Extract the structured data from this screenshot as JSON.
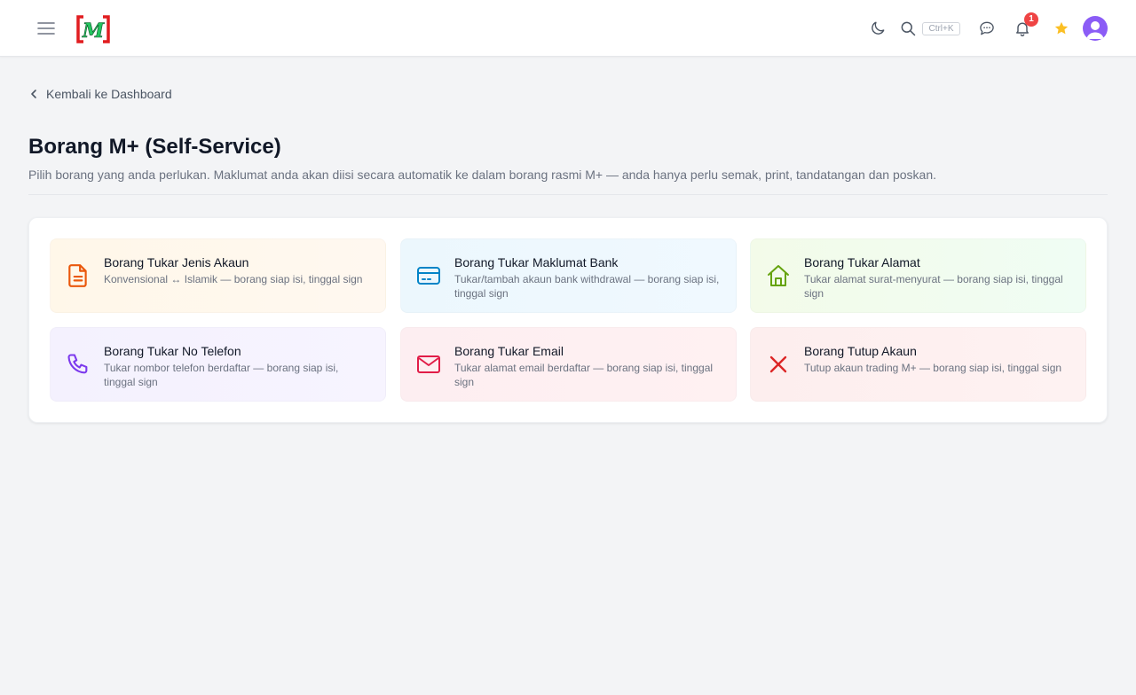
{
  "header": {
    "logo_text": "M",
    "search_shortcut": "Ctrl+K",
    "notification_count": "1",
    "icons": [
      "menu-icon",
      "moon-icon",
      "search-icon",
      "chat-icon",
      "bell-icon",
      "star-icon",
      "user-icon"
    ],
    "colors": {
      "star": "#fbbf24",
      "avatar": "#8b5cf6",
      "badge": "#ef4444"
    }
  },
  "nav": {
    "back_label": "Kembali ke Dashboard"
  },
  "page": {
    "title": "Borang M+ (Self-Service)",
    "description": "Pilih borang yang anda perlukan. Maklumat anda akan diisi secara automatik ke dalam borang rasmi M+ — anda hanya perlu semak, print, tandatangan dan poskan."
  },
  "forms": [
    {
      "title": "Borang Tukar Jenis Akaun",
      "description": "Konvensional ↔ Islamik — borang siap isi, tinggal sign",
      "icon": "document-icon",
      "color": "#ea580c"
    },
    {
      "title": "Borang Tukar Maklumat Bank",
      "description": "Tukar/tambah akaun bank withdrawal — borang siap isi, tinggal sign",
      "icon": "credit-card-icon",
      "color": "#0284c7"
    },
    {
      "title": "Borang Tukar Alamat",
      "description": "Tukar alamat surat-menyurat — borang siap isi, tinggal sign",
      "icon": "home-icon",
      "color": "#65a30d"
    },
    {
      "title": "Borang Tukar No Telefon",
      "description": "Tukar nombor telefon berdaftar — borang siap isi, tinggal sign",
      "icon": "phone-icon",
      "color": "#7c3aed"
    },
    {
      "title": "Borang Tukar Email",
      "description": "Tukar alamat email berdaftar — borang siap isi, tinggal sign",
      "icon": "mail-icon",
      "color": "#e11d48"
    },
    {
      "title": "Borang Tutup Akaun",
      "description": "Tutup akaun trading M+ — borang siap isi, tinggal sign",
      "icon": "close-icon",
      "color": "#dc2626"
    }
  ]
}
